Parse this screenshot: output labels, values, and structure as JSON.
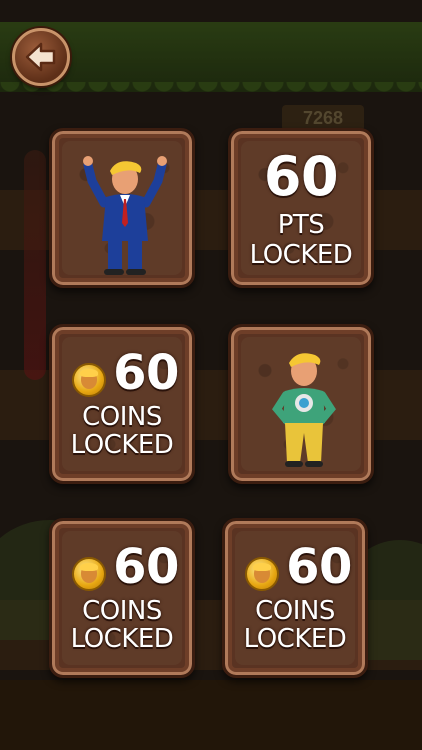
{
  "back_button": {
    "icon": "back-arrow-icon"
  },
  "background": {
    "score": "7268"
  },
  "cards": [
    {
      "type": "unlocked",
      "character": "suit-character"
    },
    {
      "type": "points",
      "amount": "60",
      "unit": "PTS",
      "status": "LOCKED"
    },
    {
      "type": "coins",
      "amount": "60",
      "unit": "COINS",
      "status": "LOCKED",
      "icon": "coin-icon"
    },
    {
      "type": "unlocked",
      "character": "casual-character"
    },
    {
      "type": "coins",
      "amount": "60",
      "unit": "COINS",
      "status": "LOCKED",
      "icon": "coin-icon"
    },
    {
      "type": "coins",
      "amount": "60",
      "unit": "COINS",
      "status": "LOCKED",
      "icon": "coin-icon"
    }
  ],
  "colors": {
    "card": "#5a3322",
    "card_border": "#b07a5a",
    "coin": "#e7a712",
    "text": "#ffffff"
  }
}
